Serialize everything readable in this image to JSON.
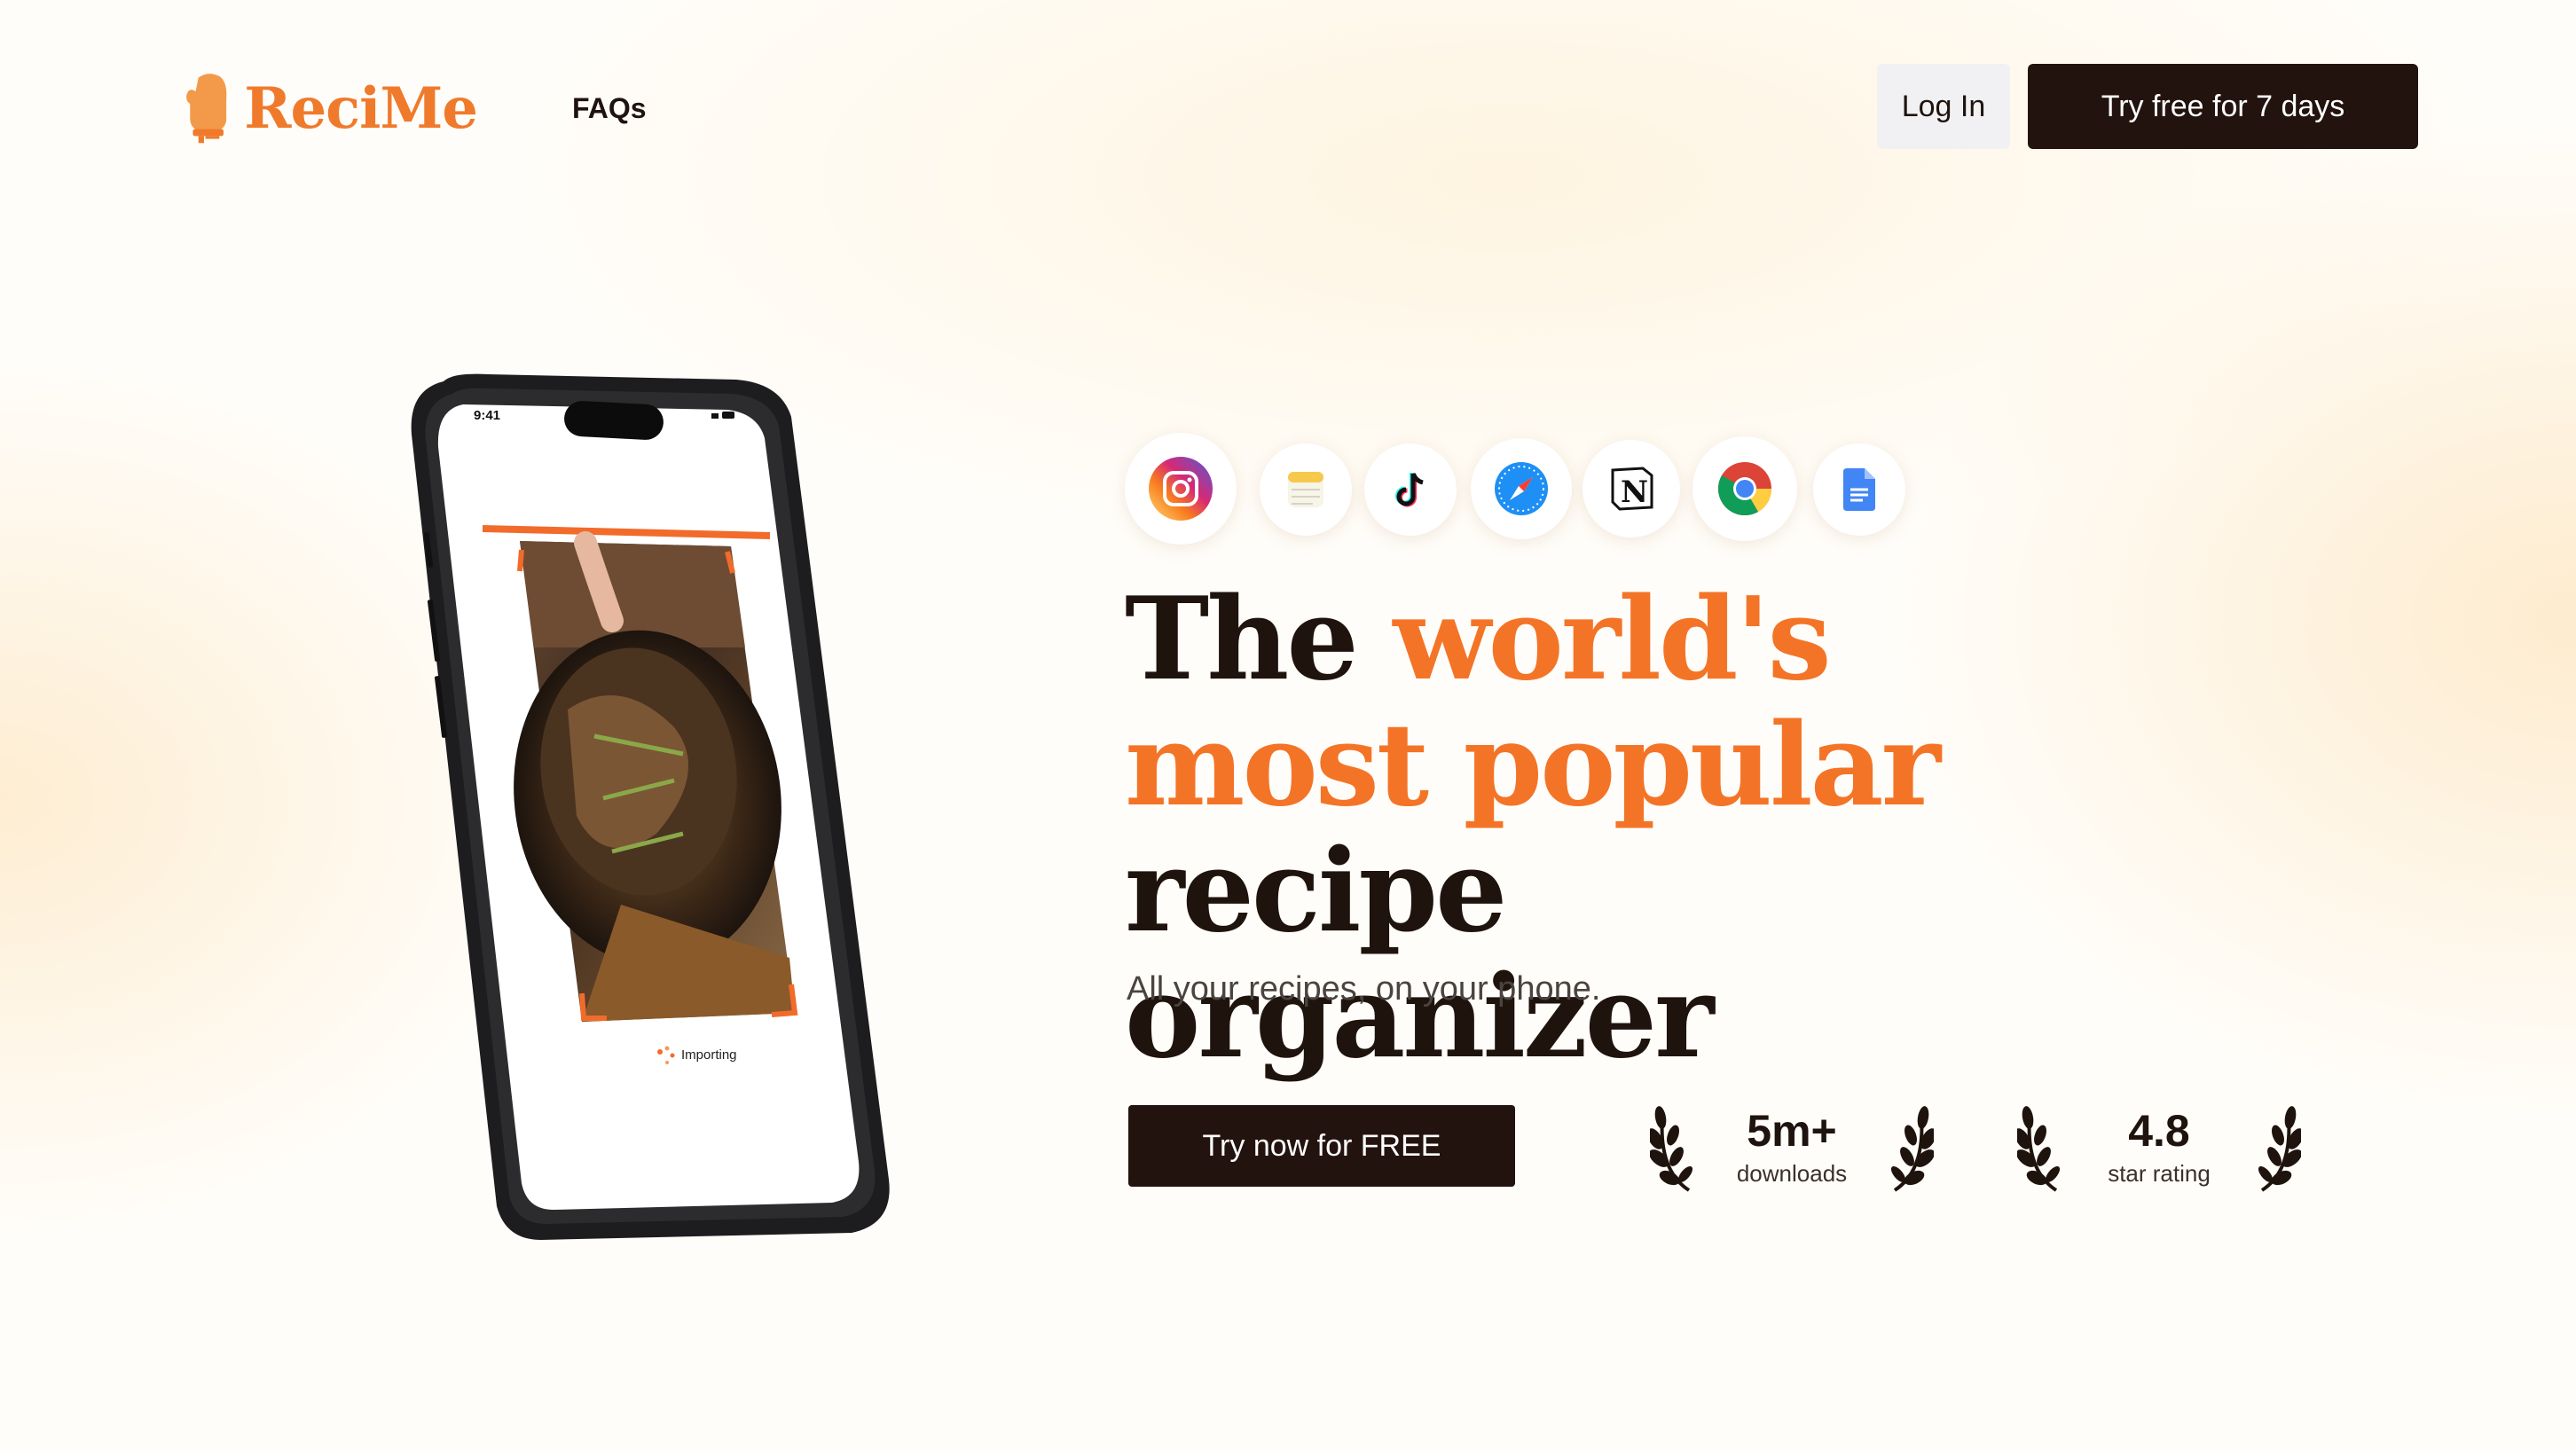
{
  "brand": {
    "name": "ReciMe",
    "color": "#f07a2c"
  },
  "nav": {
    "faqs": "FAQs"
  },
  "header": {
    "login": "Log In",
    "trial": "Try free for 7 days"
  },
  "phone": {
    "time": "9:41",
    "status": "Importing"
  },
  "sources": [
    {
      "icon": "instagram-icon"
    },
    {
      "icon": "notes-icon"
    },
    {
      "icon": "tiktok-icon"
    },
    {
      "icon": "safari-icon"
    },
    {
      "icon": "notion-icon"
    },
    {
      "icon": "chrome-icon"
    },
    {
      "icon": "google-docs-icon"
    }
  ],
  "hero": {
    "headline_1": "The ",
    "headline_accent": "world's most popular",
    "headline_2": " recipe organizer",
    "subtitle": "All your recipes, on your phone.",
    "cta": "Try now for FREE"
  },
  "stats": [
    {
      "value": "5m+",
      "caption": "downloads"
    },
    {
      "value": "4.8",
      "caption": "star rating"
    }
  ],
  "colors": {
    "accent": "#f47427",
    "dark": "#23130e"
  }
}
